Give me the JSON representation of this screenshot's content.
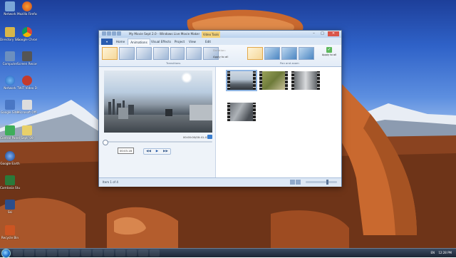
{
  "window": {
    "title": "My Movie Sept 2.0 - Windows Live Movie Maker",
    "context_tab": "Video Tools"
  },
  "tabs": [
    {
      "label": "Home"
    },
    {
      "label": "Animations"
    },
    {
      "label": "Visual Effects"
    },
    {
      "label": "Project"
    },
    {
      "label": "View"
    },
    {
      "label": "Edit"
    }
  ],
  "ribbon": {
    "transitions_label": "Transitions",
    "pan_zoom_label": "Pan and zoom",
    "duration_label": "Duration:",
    "apply_all_label": "Apply to all",
    "apply_all_button": "Apply to all"
  },
  "preview": {
    "time": "00:00:00/00:41.41",
    "tooltip_time": "00:03.18"
  },
  "status": {
    "text": "Item 1 of 4"
  },
  "taskbar": {
    "tray": "EN",
    "clock": "12:28 PM"
  },
  "desktop": {
    "icons": [
      {
        "label": "Network",
        "color": "#7ba6d8"
      },
      {
        "label": "Mozilla Firefox",
        "color": "#e36a1f"
      },
      {
        "label": "Directory Silver",
        "color": "#d8b64a"
      },
      {
        "label": "Google Chrome",
        "color": "#3c9a4a"
      },
      {
        "label": "Computer",
        "color": "#6c8fbf"
      },
      {
        "label": "Screen Recorder",
        "color": "#a33"
      },
      {
        "label": "Network",
        "color": "#3f7bd8"
      },
      {
        "label": "TWiT Video Downloader",
        "color": "#c43b2d"
      },
      {
        "label": "Google Sites",
        "color": "#4a77c4"
      },
      {
        "label": "Microsoft Office",
        "color": "#aaa"
      },
      {
        "label": "Control Panel",
        "color": "#3fae5a"
      },
      {
        "label": "Sept '09",
        "color": "#e8d06a"
      },
      {
        "label": "Google Earth",
        "color": "#2c62b8"
      },
      {
        "label": "Camtasia Studio 6",
        "color": "#2a7a3a"
      },
      {
        "label": "Ski",
        "color": "#2b4e8c"
      },
      {
        "label": "Recycle Bin",
        "color": "#cc5522"
      }
    ]
  }
}
